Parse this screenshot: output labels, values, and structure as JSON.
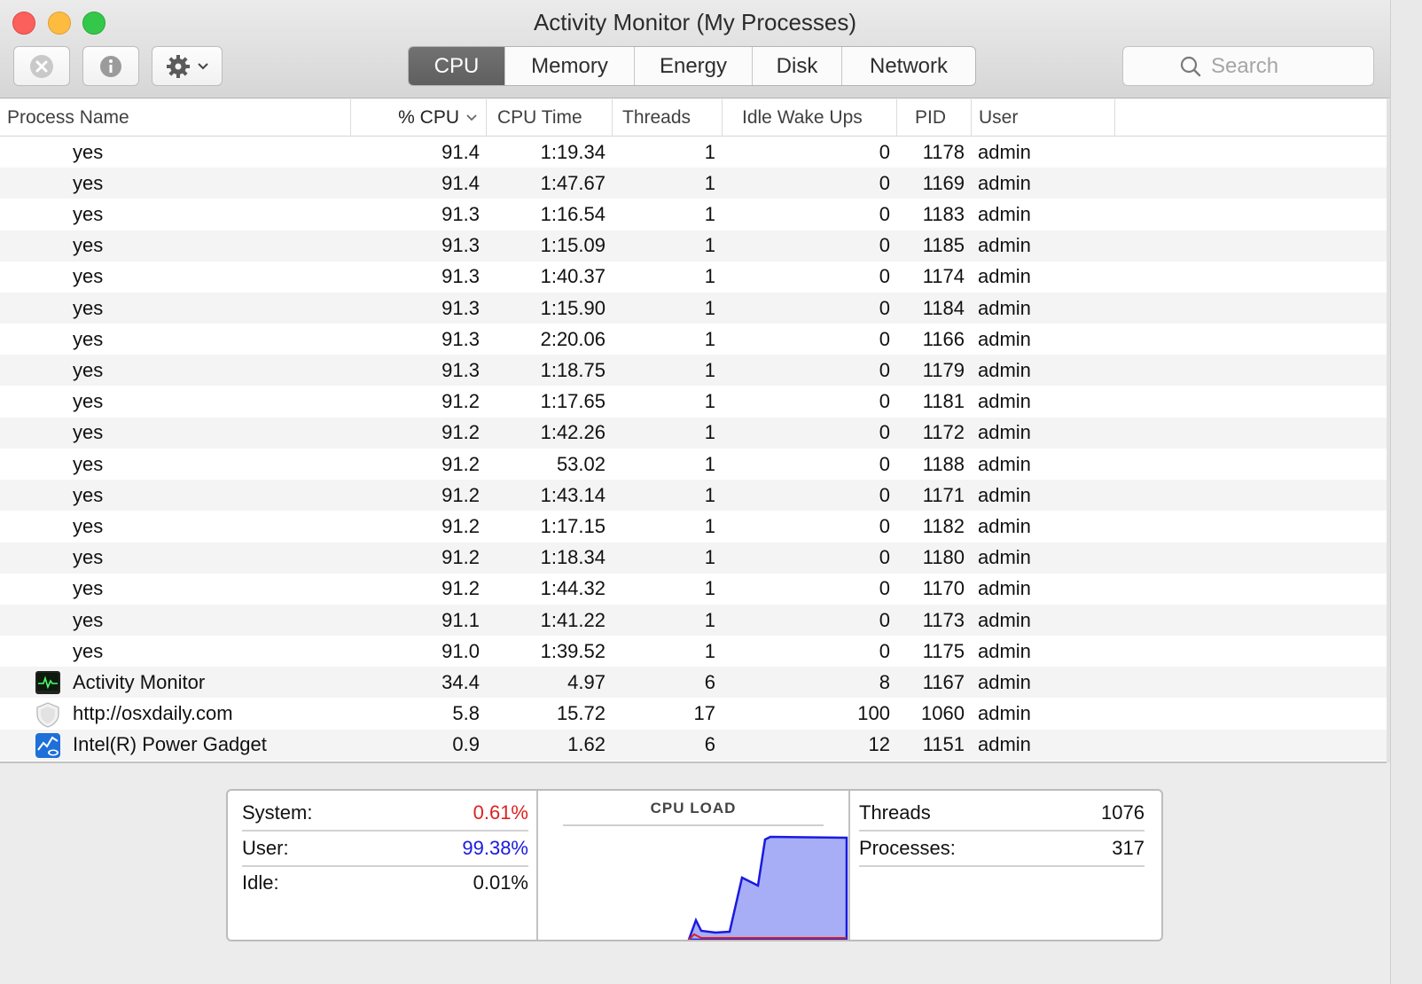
{
  "window": {
    "title": "Activity Monitor (My Processes)"
  },
  "toolbar": {
    "tabs": [
      {
        "label": "CPU",
        "active": true
      },
      {
        "label": "Memory",
        "active": false
      },
      {
        "label": "Energy",
        "active": false
      },
      {
        "label": "Disk",
        "active": false
      },
      {
        "label": "Network",
        "active": false
      }
    ],
    "search_placeholder": "Search"
  },
  "table": {
    "columns": [
      "Process Name",
      "% CPU",
      "CPU Time",
      "Threads",
      "Idle Wake Ups",
      "PID",
      "User"
    ],
    "rows": [
      {
        "name": "yes",
        "cpu": "91.4",
        "time": "1:19.34",
        "threads": "1",
        "idle": "0",
        "pid": "1178",
        "user": "admin"
      },
      {
        "name": "yes",
        "cpu": "91.4",
        "time": "1:47.67",
        "threads": "1",
        "idle": "0",
        "pid": "1169",
        "user": "admin"
      },
      {
        "name": "yes",
        "cpu": "91.3",
        "time": "1:16.54",
        "threads": "1",
        "idle": "0",
        "pid": "1183",
        "user": "admin"
      },
      {
        "name": "yes",
        "cpu": "91.3",
        "time": "1:15.09",
        "threads": "1",
        "idle": "0",
        "pid": "1185",
        "user": "admin"
      },
      {
        "name": "yes",
        "cpu": "91.3",
        "time": "1:40.37",
        "threads": "1",
        "idle": "0",
        "pid": "1174",
        "user": "admin"
      },
      {
        "name": "yes",
        "cpu": "91.3",
        "time": "1:15.90",
        "threads": "1",
        "idle": "0",
        "pid": "1184",
        "user": "admin"
      },
      {
        "name": "yes",
        "cpu": "91.3",
        "time": "2:20.06",
        "threads": "1",
        "idle": "0",
        "pid": "1166",
        "user": "admin"
      },
      {
        "name": "yes",
        "cpu": "91.3",
        "time": "1:18.75",
        "threads": "1",
        "idle": "0",
        "pid": "1179",
        "user": "admin"
      },
      {
        "name": "yes",
        "cpu": "91.2",
        "time": "1:17.65",
        "threads": "1",
        "idle": "0",
        "pid": "1181",
        "user": "admin"
      },
      {
        "name": "yes",
        "cpu": "91.2",
        "time": "1:42.26",
        "threads": "1",
        "idle": "0",
        "pid": "1172",
        "user": "admin"
      },
      {
        "name": "yes",
        "cpu": "91.2",
        "time": "53.02",
        "threads": "1",
        "idle": "0",
        "pid": "1188",
        "user": "admin"
      },
      {
        "name": "yes",
        "cpu": "91.2",
        "time": "1:43.14",
        "threads": "1",
        "idle": "0",
        "pid": "1171",
        "user": "admin"
      },
      {
        "name": "yes",
        "cpu": "91.2",
        "time": "1:17.15",
        "threads": "1",
        "idle": "0",
        "pid": "1182",
        "user": "admin"
      },
      {
        "name": "yes",
        "cpu": "91.2",
        "time": "1:18.34",
        "threads": "1",
        "idle": "0",
        "pid": "1180",
        "user": "admin"
      },
      {
        "name": "yes",
        "cpu": "91.2",
        "time": "1:44.32",
        "threads": "1",
        "idle": "0",
        "pid": "1170",
        "user": "admin"
      },
      {
        "name": "yes",
        "cpu": "91.1",
        "time": "1:41.22",
        "threads": "1",
        "idle": "0",
        "pid": "1173",
        "user": "admin"
      },
      {
        "name": "yes",
        "cpu": "91.0",
        "time": "1:39.52",
        "threads": "1",
        "idle": "0",
        "pid": "1175",
        "user": "admin"
      },
      {
        "name": "Activity Monitor",
        "icon": "activity-monitor-icon",
        "cpu": "34.4",
        "time": "4.97",
        "threads": "6",
        "idle": "8",
        "pid": "1167",
        "user": "admin"
      },
      {
        "name": "http://osxdaily.com",
        "icon": "web-content-shield-icon",
        "cpu": "5.8",
        "time": "15.72",
        "threads": "17",
        "idle": "100",
        "pid": "1060",
        "user": "admin"
      },
      {
        "name": "Intel(R) Power Gadget",
        "icon": "power-gadget-icon",
        "cpu": "0.9",
        "time": "1.62",
        "threads": "6",
        "idle": "12",
        "pid": "1151",
        "user": "admin"
      }
    ]
  },
  "summary": {
    "system_label": "System:",
    "system_value": "0.61%",
    "user_label": "User:",
    "user_value": "99.38%",
    "idle_label": "Idle:",
    "idle_value": "0.01%",
    "cpu_load_title": "CPU LOAD",
    "threads_label": "Threads",
    "threads_value": "1076",
    "processes_label": "Processes:",
    "processes_value": "317"
  },
  "colors": {
    "system": "#e02020",
    "user": "#1a1ae0",
    "accent_tab": "#676767"
  }
}
